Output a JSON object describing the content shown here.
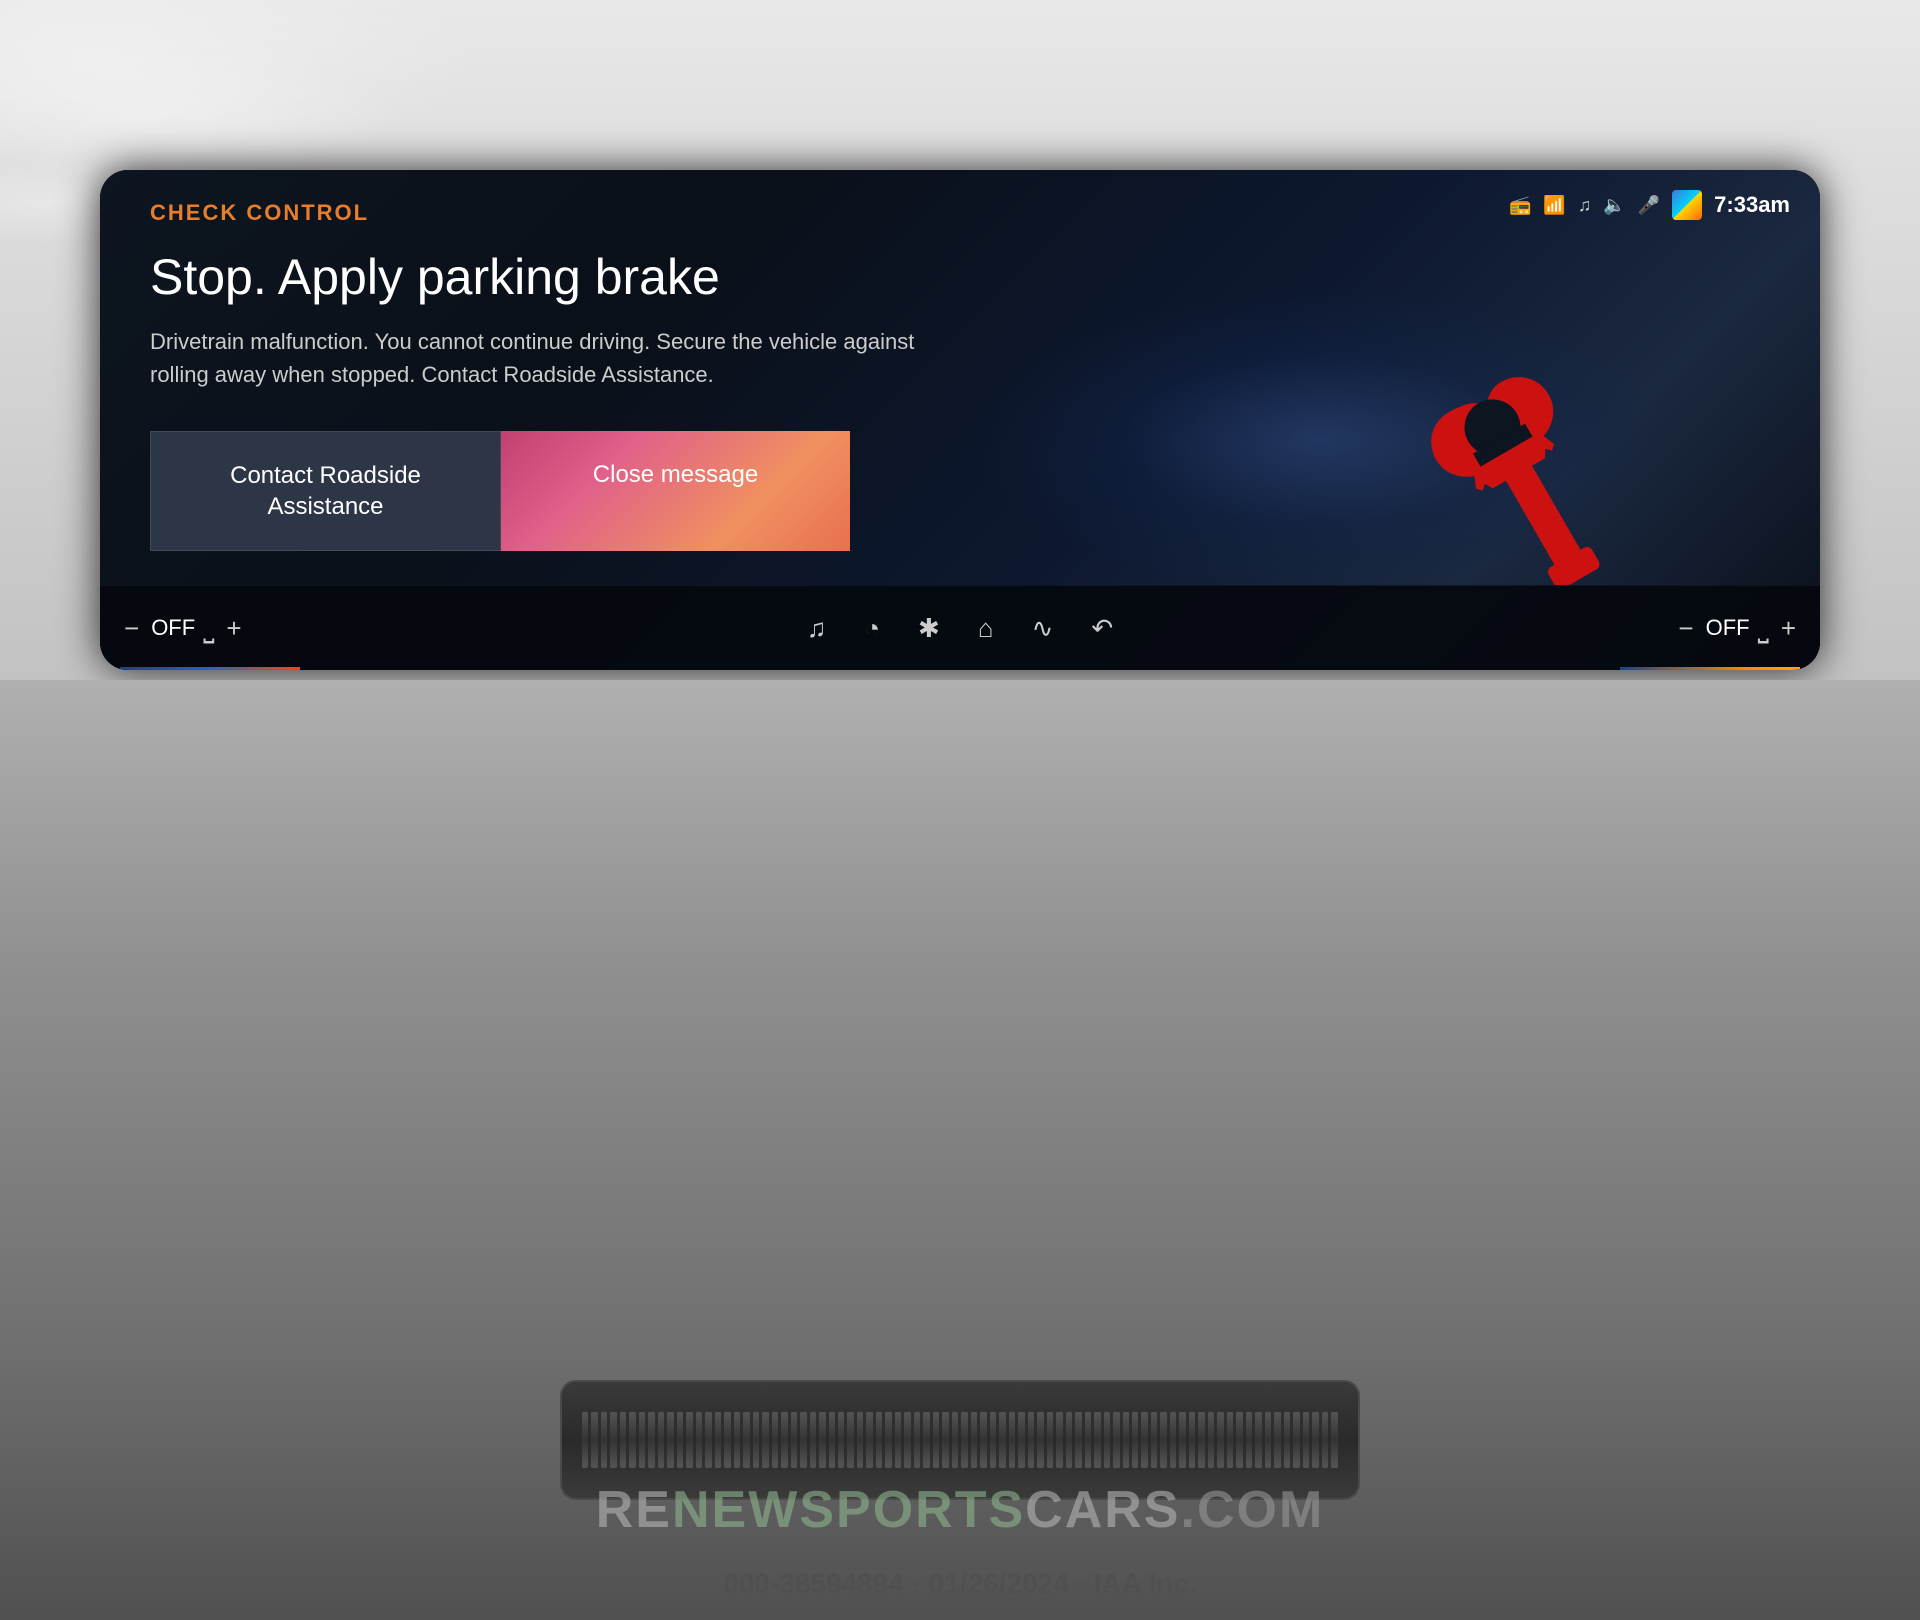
{
  "screen": {
    "check_control_label": "CHECK CONTROL",
    "alert_title": "Stop. Apply parking brake",
    "alert_description": "Drivetrain malfunction. You cannot continue driving. Secure the vehicle against rolling away when stopped. Contact Roadside Assistance.",
    "btn_roadside_label": "Contact Roadside Assistance",
    "btn_close_label": "Close message"
  },
  "status_bar": {
    "time": "7:33am",
    "icons": [
      "sim-icon",
      "wifi-icon",
      "music-icon",
      "volume-icon",
      "mic-icon",
      "nav-icon"
    ]
  },
  "toolbar": {
    "left_minus": "−",
    "left_temp": "OFF",
    "left_plus": "+",
    "center_icons": [
      "music-icon",
      "nav-icon",
      "fan-icon",
      "home-icon",
      "menu-icon",
      "back-icon"
    ],
    "right_minus": "−",
    "right_temp": "OFF",
    "right_plus": "+"
  },
  "watermark": {
    "re": "RE",
    "new": "NEW",
    "sports": "SPORTS",
    "cars": "CARS",
    "com": ".COM"
  },
  "bottom_info": {
    "text": "000-38594894 · 01/26/2024 · IAA Inc."
  }
}
